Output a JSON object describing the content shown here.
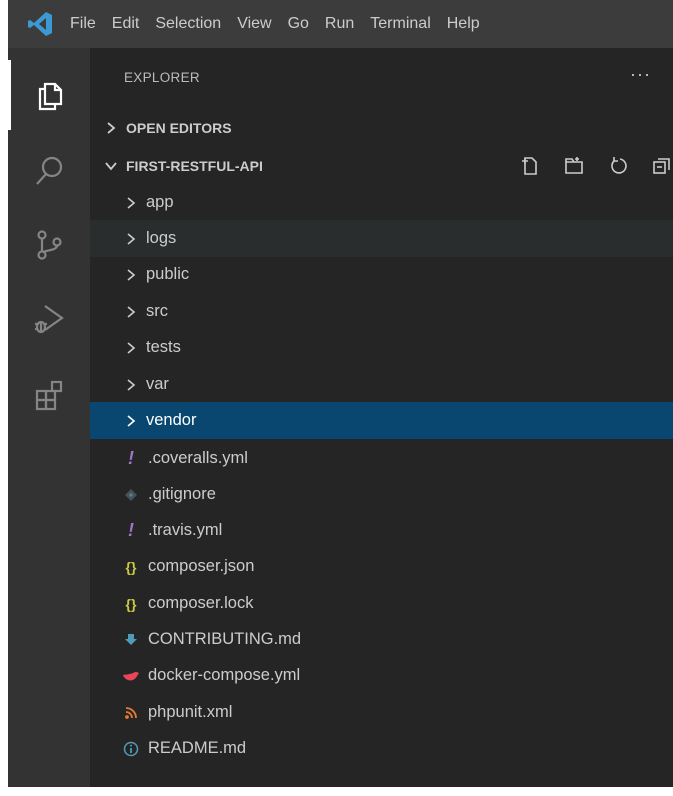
{
  "menubar": {
    "items": [
      "File",
      "Edit",
      "Selection",
      "View",
      "Go",
      "Run",
      "Terminal",
      "Help"
    ]
  },
  "activitybar": {
    "items": [
      "explorer-icon",
      "search-icon",
      "source-control-icon",
      "run-debug-icon",
      "extensions-icon"
    ]
  },
  "explorer": {
    "title": "EXPLORER",
    "more": "···",
    "open_editors": "OPEN EDITORS",
    "project": "FIRST-RESTFUL-API"
  },
  "tree": {
    "folders": [
      {
        "name": "app"
      },
      {
        "name": "logs"
      },
      {
        "name": "public"
      },
      {
        "name": "src"
      },
      {
        "name": "tests"
      },
      {
        "name": "var"
      },
      {
        "name": "vendor"
      }
    ],
    "files": [
      {
        "name": ".coveralls.yml",
        "icon": "yaml-icon"
      },
      {
        "name": ".gitignore",
        "icon": "git-icon"
      },
      {
        "name": ".travis.yml",
        "icon": "yaml-icon"
      },
      {
        "name": "composer.json",
        "icon": "json-icon"
      },
      {
        "name": "composer.lock",
        "icon": "json-icon"
      },
      {
        "name": "CONTRIBUTING.md",
        "icon": "download-icon"
      },
      {
        "name": "docker-compose.yml",
        "icon": "docker-icon"
      },
      {
        "name": "phpunit.xml",
        "icon": "rss-icon"
      },
      {
        "name": "README.md",
        "icon": "info-icon"
      }
    ]
  },
  "colors": {
    "selection": "#094771",
    "hover": "#2a2d2e",
    "vscode_blue": "#3c99d4",
    "yaml": "#a074c4",
    "json": "#cbcb41",
    "git": "#41535b",
    "markdown_download": "#519aba",
    "docker": "#e8475a",
    "xml_rss": "#e37933"
  }
}
